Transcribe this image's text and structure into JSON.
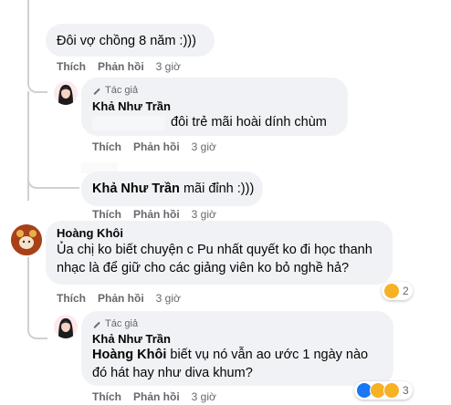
{
  "comments": [
    {
      "id": "c1",
      "text": "Đôi vợ chồng 8 năm :)))",
      "actions": {
        "like": "Thích",
        "reply": "Phản hồi",
        "time": "3 giờ"
      }
    },
    {
      "id": "c2",
      "author_tag": "Tác giả",
      "author": "Khả Như Trần",
      "text": "đôi trẻ mãi hoài dính chùm",
      "actions": {
        "like": "Thích",
        "reply": "Phản hồi",
        "time": "3 giờ"
      }
    },
    {
      "id": "c3",
      "mention": "Khả Như Trần",
      "text": "mãi đỉnh :)))",
      "actions": {
        "like": "Thích",
        "reply": "Phản hồi",
        "time": "3 giờ"
      }
    },
    {
      "id": "c4",
      "author": "Hoàng Khôi",
      "text": "Ủa chị ko biết chuyện c Pu nhất quyết ko đi học thanh nhạc là để giữ cho các giảng viên ko bỏ nghề hả?",
      "actions": {
        "like": "Thích",
        "reply": "Phản hồi",
        "time": "3 giờ"
      },
      "reactions": {
        "count": "2",
        "icons": [
          "haha-icon"
        ]
      }
    },
    {
      "id": "c5",
      "author_tag": "Tác giả",
      "author": "Khả Như Trần",
      "mention": "Hoàng Khôi",
      "text": "biết vụ nó vẫn ao ước 1 ngày nào đó hát hay như diva khum?",
      "actions": {
        "like": "Thích",
        "reply": "Phản hồi",
        "time": "3 giờ"
      },
      "reactions": {
        "count": "3",
        "icons": [
          "like-icon",
          "haha-icon",
          "wow-icon"
        ]
      }
    }
  ],
  "colors": {
    "bubble": "#f0f2f5",
    "meta": "#65676b",
    "text": "#050505",
    "like": "#1877f2",
    "haha": "#f7b125"
  }
}
